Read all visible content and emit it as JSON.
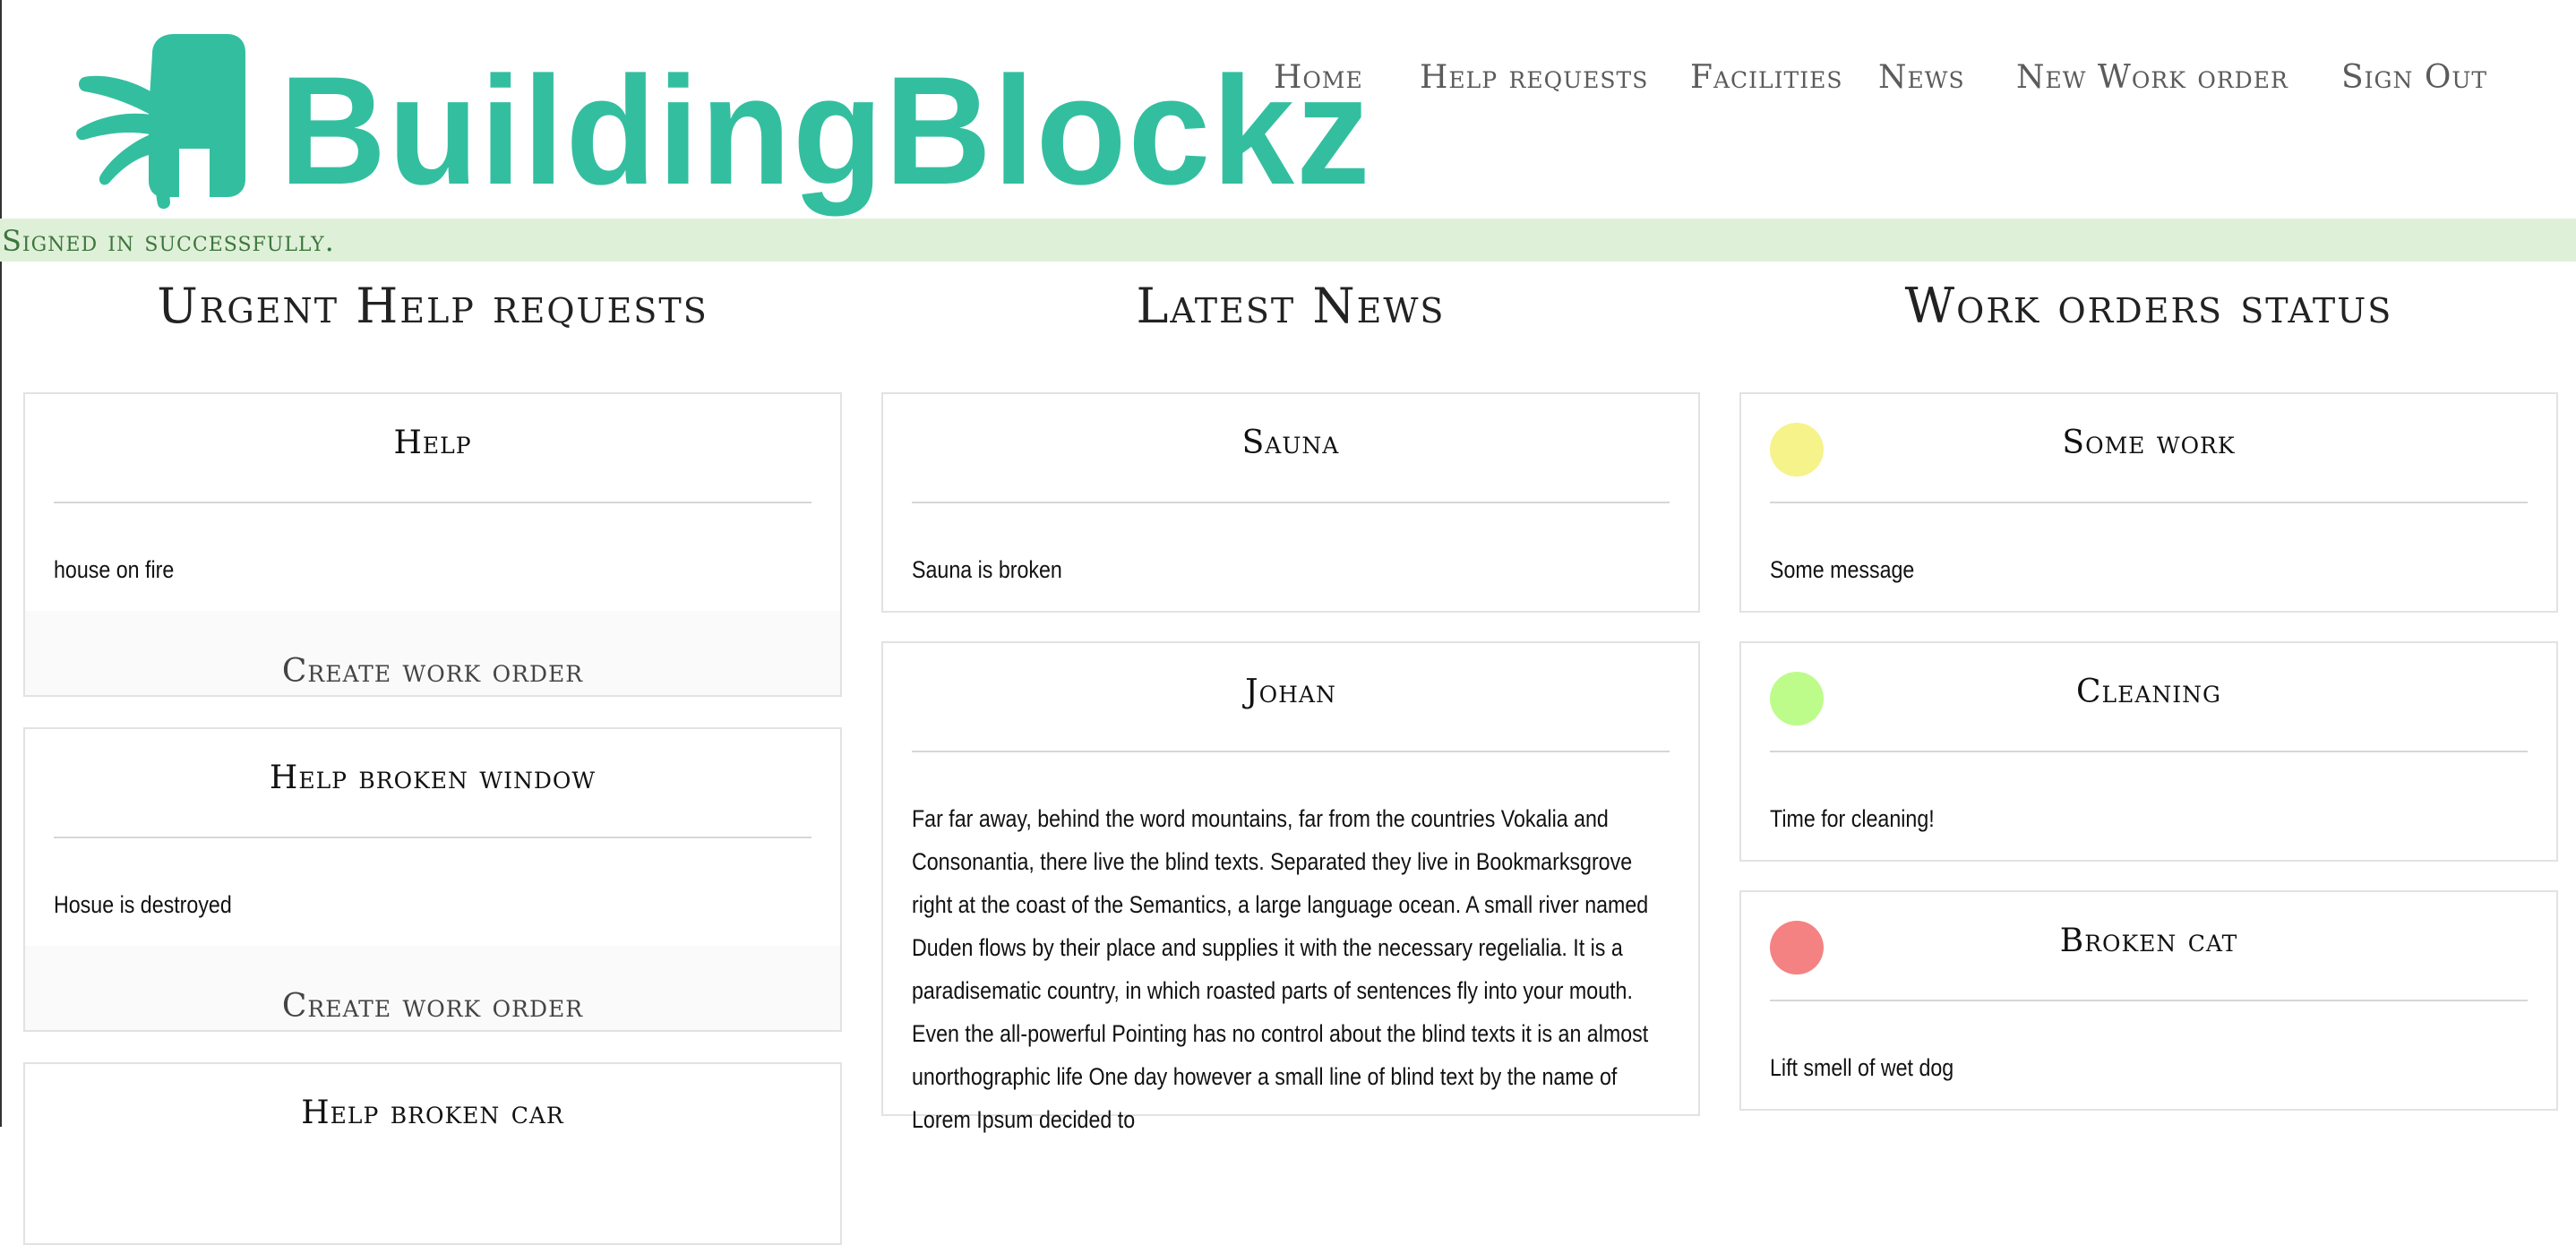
{
  "brand": {
    "name": "BuildingBlockz",
    "color": "#33bf9f"
  },
  "nav": {
    "items": [
      {
        "label": "Home"
      },
      {
        "label": "Help requests"
      },
      {
        "label": "Facilities"
      },
      {
        "label": "News"
      },
      {
        "label": "New Work order"
      },
      {
        "label": "Sign Out"
      }
    ]
  },
  "flash": {
    "message": "Signed in successfully."
  },
  "help": {
    "heading": "Urgent Help requests",
    "action_label": "Create work order",
    "items": [
      {
        "title": "Help",
        "body": "house on fire"
      },
      {
        "title": "Help broken window",
        "body": "Hosue is destroyed"
      },
      {
        "title": "Help broken car",
        "body": ""
      }
    ]
  },
  "news": {
    "heading": "Latest News",
    "items": [
      {
        "title": "Sauna",
        "body": "Sauna is broken"
      },
      {
        "title": "Johan",
        "body": "Far far away, behind the word mountains, far from the countries Vokalia and Consonantia, there live the blind texts. Separated they live in Bookmarksgrove right at the coast of the Semantics, a large language ocean. A small river named Duden flows by their place and supplies it with the necessary regelialia. It is a paradisematic country, in which roasted parts of sentences fly into your mouth. Even the all-powerful Pointing has no control about the blind texts it is an almost unorthographic life One day however a small line of blind text by the name of Lorem Ipsum decided to"
      }
    ]
  },
  "work_orders": {
    "heading": "Work orders status",
    "items": [
      {
        "title": "Some work",
        "body": "Some message",
        "status_color": "#f5f38a"
      },
      {
        "title": "Cleaning",
        "body": "Time for cleaning!",
        "status_color": "#bdfc8a"
      },
      {
        "title": "Broken cat",
        "body": "Lift smell of wet dog",
        "status_color": "#f58282"
      }
    ]
  }
}
